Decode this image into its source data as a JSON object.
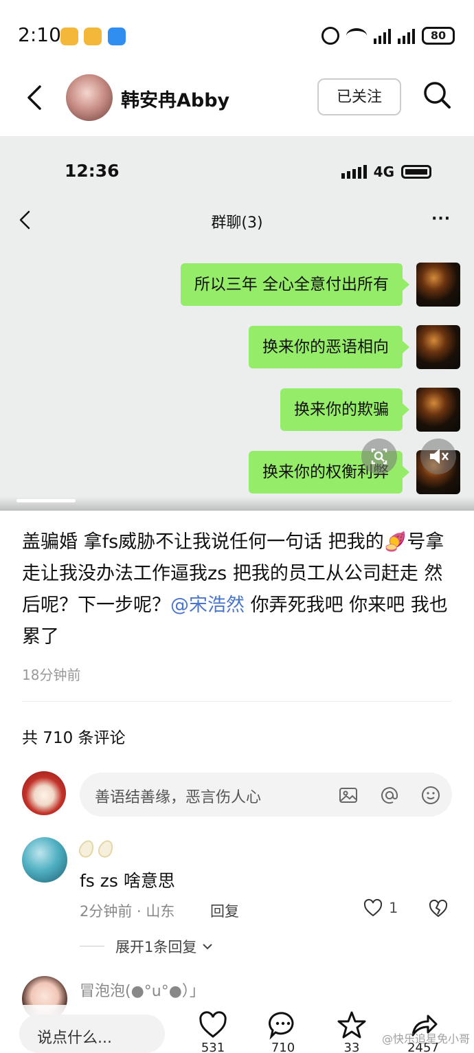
{
  "status_bar": {
    "time": "2:10",
    "battery": "80"
  },
  "header": {
    "username": "韩安冉Abby",
    "follow_label": "已关注"
  },
  "embedded_screenshot": {
    "time": "12:36",
    "network": "4G",
    "chat_title": "群聊(3)",
    "more": "···",
    "messages": [
      "所以三年 全心全意付出所有",
      "换来你的恶语相向",
      "换来你的欺骗",
      "换来你的权衡利弊"
    ]
  },
  "post": {
    "text_before_mention": "盖骗婚 拿fs威胁不让我说任何一句话 把我的🍠号拿走让我没办法工作逼我zs  把我的员工从公司赶走 然后呢？下一步呢？",
    "mention": "@宋浩然",
    "text_after_mention": " 你弄死我吧 你来吧 我也累了",
    "time": "18分钟前"
  },
  "comments": {
    "count_label": "共 710 条评论",
    "input_placeholder": "善语结善缘，恶言伤人心",
    "items": [
      {
        "text": "fs zs 啥意思",
        "meta": "2分钟前 · 山东",
        "reply_label": "回复",
        "likes": "1",
        "expand_label": "展开1条回复"
      },
      {
        "name": "冒泡泡(●°u°●）」"
      }
    ]
  },
  "bottom_bar": {
    "say_placeholder": "说点什么...",
    "likes": "531",
    "comments": "710",
    "favorites": "33",
    "shares": "2457",
    "watermark": "@快乐追星免小哥"
  },
  "colors": {
    "bubble": "#95ec69",
    "mention": "#4a76c9",
    "screenshot_bg": "#eceeed"
  },
  "icons": [
    "back-icon",
    "search-icon",
    "image-icon",
    "at-icon",
    "emoji-icon",
    "heart-icon",
    "comment-icon",
    "star-icon",
    "share-icon",
    "broken-heart-icon",
    "chevron-down-icon",
    "zoom-icon",
    "mute-icon"
  ]
}
